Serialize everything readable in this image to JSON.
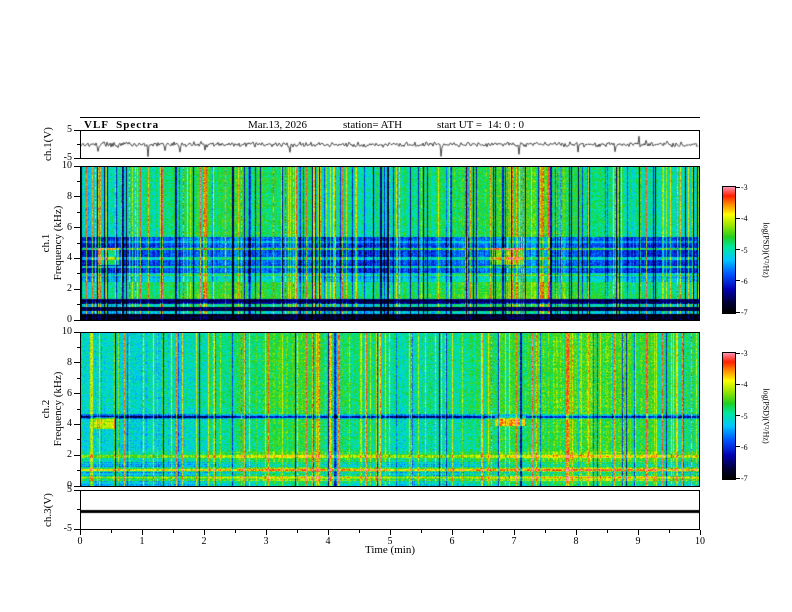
{
  "figure": {
    "background": "#ffffff",
    "header": {
      "title": "VLF  Spectra",
      "date": "Mar.13, 2026",
      "station": "station= ATH",
      "start_ut": "start UT =  14: 0 : 0"
    },
    "xaxis": {
      "label": "Time (min)",
      "ticks": [
        0,
        1,
        2,
        3,
        4,
        5,
        6,
        7,
        8,
        9,
        10
      ],
      "range": [
        0,
        10
      ]
    }
  },
  "colormap": [
    [
      0.0,
      "#000000"
    ],
    [
      0.08,
      "#00003a"
    ],
    [
      0.18,
      "#0000b0"
    ],
    [
      0.3,
      "#0050ff"
    ],
    [
      0.42,
      "#00c8ff"
    ],
    [
      0.52,
      "#00e8a0"
    ],
    [
      0.6,
      "#20d020"
    ],
    [
      0.7,
      "#a0e800"
    ],
    [
      0.78,
      "#ffff00"
    ],
    [
      0.86,
      "#ff9000"
    ],
    [
      0.93,
      "#ff2000"
    ],
    [
      1.0,
      "#ff90b0"
    ]
  ],
  "chart_data": [
    {
      "type": "line",
      "name": "ch1-waveform",
      "ylabel": "ch.1(V)",
      "ylim": [
        -5,
        5
      ],
      "yticks": [
        5,
        -5
      ],
      "x_range": [
        0,
        10
      ],
      "signal": "broadband VLF noise around 0 V with impulsive sferic spikes reaching ±5 V",
      "gen": {
        "seed": 20260313,
        "rms": 0.8,
        "spike_prob": 0.02,
        "spike_max": 5
      }
    },
    {
      "type": "heatmap",
      "name": "ch1-spectrogram",
      "ylabel": [
        "ch.1",
        "Frequency (kHz)"
      ],
      "ylim": [
        0,
        10
      ],
      "yticks": [
        0,
        2,
        4,
        6,
        8,
        10
      ],
      "xlim": [
        0,
        10
      ],
      "colorbar": {
        "label": "log(PSD)(V²/Hz)",
        "ticks": [
          -3,
          -4,
          -5,
          -6,
          -7
        ],
        "range": [
          -7,
          -3
        ]
      },
      "gen": {
        "seed": 1111,
        "noise": 0.13,
        "bright_prob": 0.15,
        "bright_amp": 0.32,
        "dark_prob": 0.13,
        "dark_amp": 0.38,
        "bands": [
          {
            "f": [
              0,
              0.35
            ],
            "v": 0.04,
            "jit": 0.05
          },
          {
            "f": [
              0.35,
              0.55
            ],
            "v": 0.42,
            "jit": 0.1
          },
          {
            "f": [
              0.55,
              0.8
            ],
            "v": 0.07,
            "jit": 0.05
          },
          {
            "f": [
              0.8,
              1.0
            ],
            "v": 0.48,
            "jit": 0.1
          },
          {
            "f": [
              1.0,
              1.35
            ],
            "v": 0.12,
            "jit": 0.08
          },
          {
            "f": [
              1.35,
              2.45
            ],
            "v": 0.55,
            "jit": 0.05
          },
          {
            "f": [
              2.45,
              2.95
            ],
            "v": 0.42,
            "jit": 0.05
          },
          {
            "f": [
              2.95,
              5.4
            ],
            "v": 0.27,
            "jit": 0.04
          },
          {
            "f": [
              5.4,
              10.01
            ],
            "v": 0.52,
            "jit": 0.04
          }
        ],
        "hlines": [
          {
            "f": 4.65,
            "dv": 0.3
          },
          {
            "f": 4.0,
            "dv": 0.2
          },
          {
            "f": 3.45,
            "dv": 0.24
          },
          {
            "f": 2.95,
            "dv": 0.18
          },
          {
            "f": 5.1,
            "dv": 0.14
          }
        ],
        "patches": [
          {
            "t": [
              0.25,
              0.6
            ],
            "f": [
              3.6,
              4.7
            ],
            "dv": 0.3
          },
          {
            "t": [
              6.65,
              7.15
            ],
            "f": [
              3.6,
              4.7
            ],
            "dv": 0.3
          }
        ]
      }
    },
    {
      "type": "heatmap",
      "name": "ch2-spectrogram",
      "ylabel": [
        "ch.2",
        "Frequency (kHz)"
      ],
      "ylim": [
        0,
        10
      ],
      "yticks": [
        0,
        2,
        4,
        6,
        8,
        10
      ],
      "xlim": [
        0,
        10
      ],
      "colorbar": {
        "label": "log(PSD)(V²/Hz)",
        "ticks": [
          -3,
          -4,
          -5,
          -6,
          -7
        ],
        "range": [
          -7,
          -3
        ]
      },
      "gen": {
        "seed": 2222,
        "noise": 0.15,
        "bright_prob": 0.15,
        "bright_amp": 0.3,
        "dark_prob": 0.07,
        "dark_amp": 0.32,
        "bands": [
          {
            "f": [
              0,
              0.3
            ],
            "v": 0.5,
            "jit": 0.2
          },
          {
            "f": [
              0.3,
              0.6
            ],
            "v": 0.6,
            "jit": 0.15
          },
          {
            "f": [
              0.6,
              0.95
            ],
            "v": 0.45,
            "jit": 0.2
          },
          {
            "f": [
              0.95,
              1.2
            ],
            "v": 0.62,
            "jit": 0.12
          },
          {
            "f": [
              1.2,
              1.6
            ],
            "v": 0.5,
            "jit": 0.15
          },
          {
            "f": [
              1.6,
              2.3
            ],
            "v": 0.58,
            "jit": 0.08
          },
          {
            "f": [
              2.3,
              4.35
            ],
            "v": 0.52,
            "jit": 0.05
          },
          {
            "f": [
              4.35,
              4.7
            ],
            "v": 0.38,
            "jit": 0.05
          },
          {
            "f": [
              4.7,
              10.01
            ],
            "v": 0.54,
            "jit": 0.04
          }
        ],
        "hlines": [
          {
            "f": 4.5,
            "dv": -0.22
          },
          {
            "f": 1.9,
            "dv": 0.12
          },
          {
            "f": 1.0,
            "dv": 0.18
          },
          {
            "f": 0.5,
            "dv": 0.15
          }
        ],
        "patches": [
          {
            "t": [
              0.2,
              0.55
            ],
            "f": [
              3.7,
              4.5
            ],
            "dv": 0.26
          },
          {
            "t": [
              6.7,
              7.2
            ],
            "f": [
              3.9,
              4.6
            ],
            "dv": 0.26
          }
        ]
      }
    },
    {
      "type": "line",
      "name": "ch3-flat",
      "ylabel": "ch.3(V)",
      "ylim": [
        -5,
        5
      ],
      "yticks": [
        5,
        -5
      ],
      "value": -0.25,
      "signal": "constant flat level (channel inactive)"
    }
  ]
}
